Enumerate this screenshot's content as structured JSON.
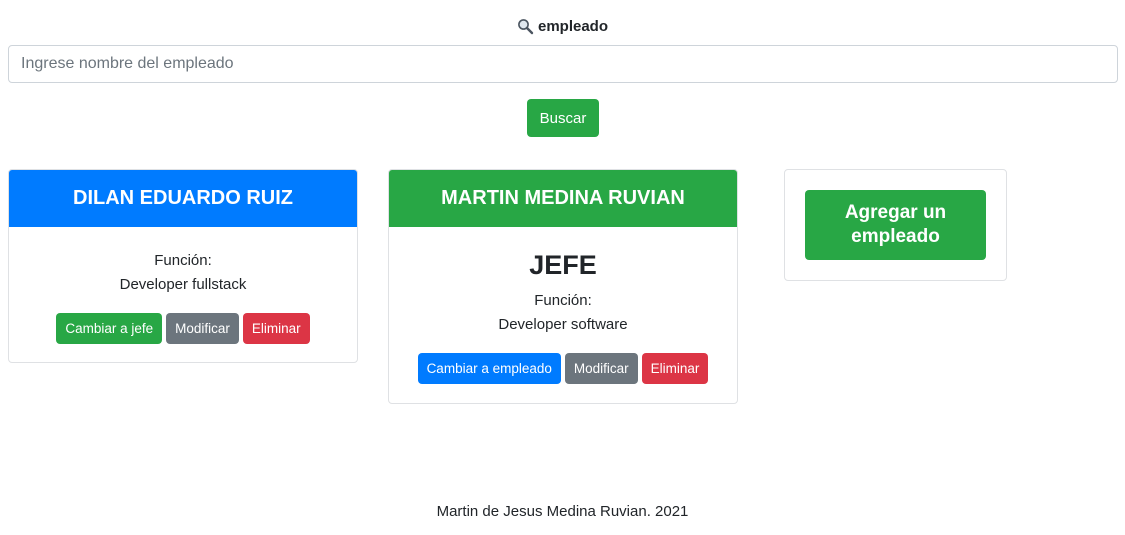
{
  "search": {
    "title": "empleado",
    "placeholder": "Ingrese nombre del empleado",
    "value": "",
    "button_label": "Buscar",
    "icon": "magnifier-icon"
  },
  "employees": [
    {
      "name": "DILAN EDUARDO RUIZ",
      "header_color": "#007bff",
      "role_badge": "",
      "function_label": "Función:",
      "function_value": "Developer fullstack",
      "actions": {
        "toggle_role": "Cambiar a jefe",
        "modify": "Modificar",
        "delete": "Eliminar"
      }
    },
    {
      "name": "MARTIN MEDINA RUVIAN",
      "header_color": "#28a745",
      "role_badge": "JEFE",
      "function_label": "Función:",
      "function_value": "Developer software",
      "actions": {
        "toggle_role": "Cambiar a empleado",
        "modify": "Modificar",
        "delete": "Eliminar"
      }
    }
  ],
  "add_employee": {
    "label": "Agregar un empleado"
  },
  "footer": {
    "text": "Martin de Jesus Medina Ruvian. 2021"
  },
  "colors": {
    "success": "#28a745",
    "primary": "#007bff",
    "secondary": "#6c757d",
    "danger": "#dc3545"
  }
}
